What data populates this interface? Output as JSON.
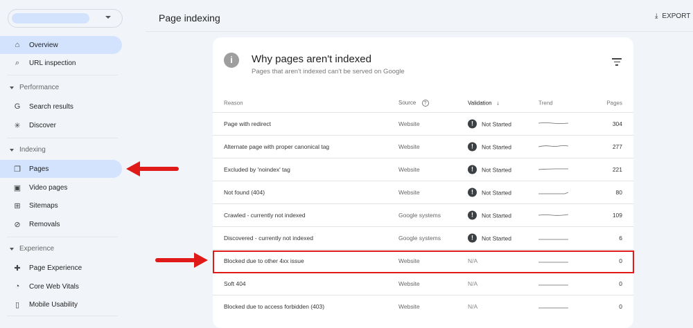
{
  "sidebar": {
    "items": [
      {
        "label": "Overview",
        "icon": "home-icon",
        "glyph": "⌂"
      },
      {
        "label": "URL inspection",
        "icon": "search-icon",
        "glyph": "⌕"
      },
      {
        "label": "Search results",
        "icon": "google-icon",
        "glyph": "G"
      },
      {
        "label": "Discover",
        "icon": "asterisk-icon",
        "glyph": "✳"
      },
      {
        "label": "Pages",
        "icon": "pages-icon",
        "glyph": "❐"
      },
      {
        "label": "Video pages",
        "icon": "video-pages-icon",
        "glyph": "▣"
      },
      {
        "label": "Sitemaps",
        "icon": "sitemap-icon",
        "glyph": "⊞"
      },
      {
        "label": "Removals",
        "icon": "eye-off-icon",
        "glyph": "⊘"
      },
      {
        "label": "Page Experience",
        "icon": "plus-circle-icon",
        "glyph": "✚"
      },
      {
        "label": "Core Web Vitals",
        "icon": "gauge-icon",
        "glyph": "◔"
      },
      {
        "label": "Mobile Usability",
        "icon": "phone-icon",
        "glyph": "▯"
      }
    ],
    "sections": [
      "Performance",
      "Indexing",
      "Experience"
    ]
  },
  "header": {
    "title": "Page indexing",
    "export_label": "EXPORT"
  },
  "card": {
    "title": "Why pages aren't indexed",
    "subtitle": "Pages that aren't indexed can't be served on Google",
    "columns": [
      "Reason",
      "Source",
      "Validation",
      "Trend",
      "Pages"
    ],
    "rows": [
      {
        "reason": "Page with redirect",
        "source": "Website",
        "validation": "Not Started",
        "pages": "304"
      },
      {
        "reason": "Alternate page with proper canonical tag",
        "source": "Website",
        "validation": "Not Started",
        "pages": "277"
      },
      {
        "reason": "Excluded by 'noindex' tag",
        "source": "Website",
        "validation": "Not Started",
        "pages": "221"
      },
      {
        "reason": "Not found (404)",
        "source": "Website",
        "validation": "Not Started",
        "pages": "80"
      },
      {
        "reason": "Crawled - currently not indexed",
        "source": "Google systems",
        "validation": "Not Started",
        "pages": "109"
      },
      {
        "reason": "Discovered - currently not indexed",
        "source": "Google systems",
        "validation": "Not Started",
        "pages": "6"
      },
      {
        "reason": "Blocked due to other 4xx issue",
        "source": "Website",
        "validation": "N/A",
        "pages": "0"
      },
      {
        "reason": "Soft 404",
        "source": "Website",
        "validation": "N/A",
        "pages": "0"
      },
      {
        "reason": "Blocked due to access forbidden (403)",
        "source": "Website",
        "validation": "N/A",
        "pages": "0"
      }
    ]
  },
  "colors": {
    "active_nav": "#d3e3fd",
    "highlight": "#e01919",
    "arrow": "#e01919"
  }
}
